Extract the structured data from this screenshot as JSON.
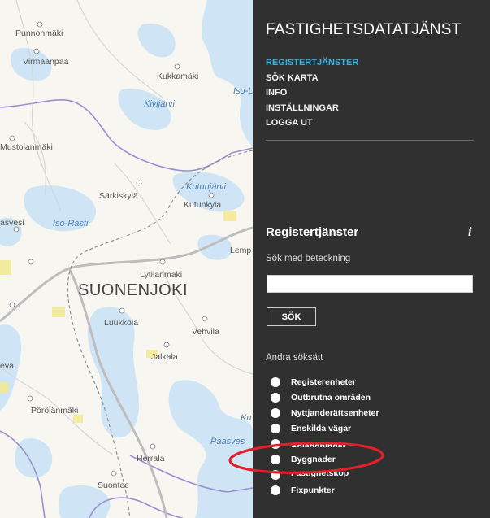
{
  "map": {
    "places": [
      "Punnonmäki",
      "Virmaanpää",
      "Kukkamäki",
      "Mustolanmäki",
      "Särkiskylä",
      "Kutunkylä",
      "Lytilänmäki",
      "Luukkola",
      "Vehvilä",
      "Jalkala",
      "Pörölänmäki",
      "Herrala",
      "Suontee",
      "Lemp",
      "asvesi",
      "evä"
    ],
    "water_names": [
      "Iso-La",
      "Kivijärvi",
      "Kutunjärvi",
      "Iso-Rasti",
      "Paasves",
      "Ku"
    ],
    "town": "SUONENJOKI"
  },
  "header": {
    "title": "FASTIGHETSDATATJÄNST"
  },
  "nav": {
    "items": [
      "REGISTERTJÄNSTER",
      "SÖK KARTA",
      "INFO",
      "INSTÄLLNINGAR",
      "LOGGA UT"
    ],
    "active": "REGISTERTJÄNSTER"
  },
  "panel": {
    "title": "Registertjänster",
    "info_icon": "info-icon",
    "search_label": "Sök med beteckning",
    "search_value": "",
    "search_button": "SÖK",
    "alt_label": "Andra söksätt",
    "options": [
      "Registerenheter",
      "Outbrutna områden",
      "Nyttjanderättsenheter",
      "Enskilda vägar",
      "Anläggningar",
      "Byggnader",
      "Fastighetsköp",
      "Fixpunkter"
    ]
  },
  "colors": {
    "panel_bg": "#303030",
    "active_nav": "#2fb7e6",
    "annotation": "#e0202a",
    "water": "#cfe5f5",
    "field": "#f3ea95"
  }
}
